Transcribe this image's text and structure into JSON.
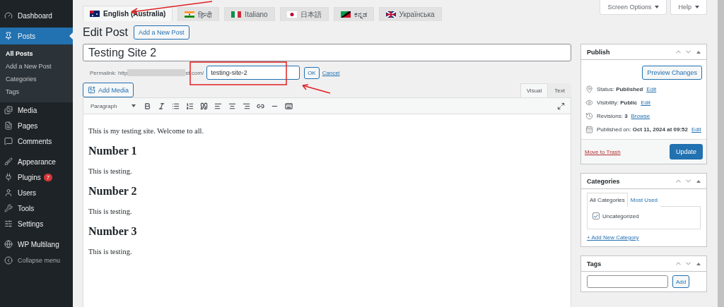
{
  "sidebar": {
    "items": [
      {
        "label": "Dashboard",
        "selected": false
      },
      {
        "label": "Posts",
        "selected": true,
        "children": [
          {
            "label": "All Posts",
            "selected": true
          },
          {
            "label": "Add a New Post",
            "selected": false
          },
          {
            "label": "Categories",
            "selected": false
          },
          {
            "label": "Tags",
            "selected": false
          }
        ]
      },
      {
        "label": "Media",
        "selected": false
      },
      {
        "label": "Pages",
        "selected": false
      },
      {
        "label": "Comments",
        "selected": false
      },
      {
        "label": "Appearance",
        "selected": false
      },
      {
        "label": "Plugins",
        "selected": false,
        "badge": "7"
      },
      {
        "label": "Users",
        "selected": false
      },
      {
        "label": "Tools",
        "selected": false
      },
      {
        "label": "Settings",
        "selected": false
      },
      {
        "label": "WP Multilang",
        "selected": false
      }
    ],
    "collapse": "Collapse menu"
  },
  "language_tabs": [
    {
      "label": "English (Australia)",
      "selected": true
    },
    {
      "label": "हिन्दी",
      "selected": false
    },
    {
      "label": "Italiano",
      "selected": false
    },
    {
      "label": "日本語",
      "selected": false
    },
    {
      "label": "ಕನ್ನಡ",
      "selected": false
    },
    {
      "label": "Українська",
      "selected": false
    }
  ],
  "screen_options": "Screen Options",
  "help": "Help",
  "heading": "Edit Post",
  "add_new": "Add a New Post",
  "title_field": {
    "value": "Testing Site 2"
  },
  "permalink": {
    "label": "Permalink: http",
    "url_end": "st.com/",
    "slug": "testing-site-2",
    "ok": "OK",
    "cancel": "Cancel"
  },
  "add_media": "Add Media",
  "editor_tabs": [
    {
      "label": "Visual",
      "selected": true
    },
    {
      "label": "Text",
      "selected": false
    }
  ],
  "format_select": "Paragraph",
  "content": [
    {
      "kind": "paragraph",
      "text": "This is my testing site. Welcome to all."
    },
    {
      "kind": "heading",
      "text": "Number 1"
    },
    {
      "kind": "paragraph",
      "text": "This is testing."
    },
    {
      "kind": "heading",
      "text": "Number 2"
    },
    {
      "kind": "paragraph",
      "text": "This is testing."
    },
    {
      "kind": "heading",
      "text": "Number 3"
    },
    {
      "kind": "paragraph",
      "text": "This is testing."
    }
  ],
  "publish": {
    "title": "Publish",
    "preview": "Preview Changes",
    "rows": [
      {
        "label": "Status:",
        "value": "Published",
        "link": "Edit"
      },
      {
        "label": "Visibility:",
        "value": "Public",
        "link": "Edit"
      },
      {
        "label": "Revisions:",
        "value": "3",
        "link": "Browse"
      },
      {
        "label": "Published on:",
        "value": "Oct 11, 2024 at 09:52",
        "link": "Edit"
      }
    ],
    "trash": "Move to Trash",
    "update": "Update"
  },
  "categories": {
    "title": "Categories",
    "tabs": [
      {
        "label": "All Categories",
        "selected": true
      },
      {
        "label": "Most Used",
        "selected": false
      }
    ],
    "items": [
      {
        "label": "Uncategorized",
        "checked": true
      }
    ],
    "add_link": "+ Add New Category"
  },
  "tags": {
    "title": "Tags",
    "add": "Add"
  }
}
